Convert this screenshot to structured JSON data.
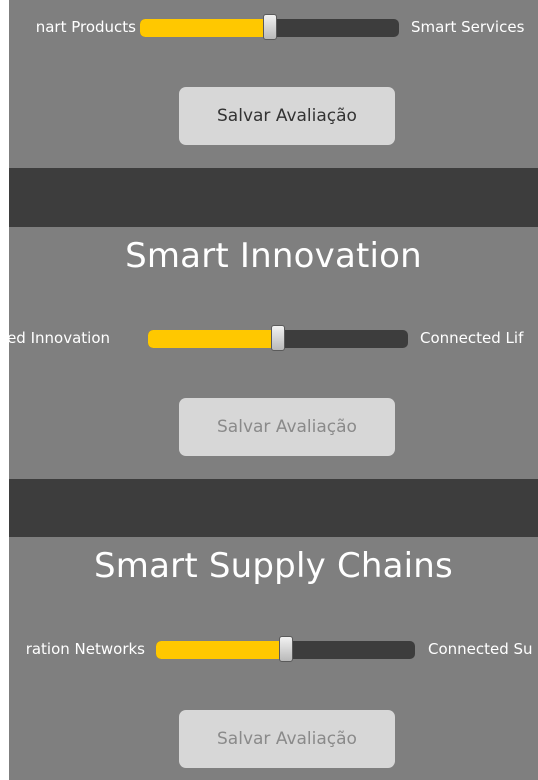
{
  "colors": {
    "panel_background": "#7f7f7f",
    "section_band": "#3d3d3d",
    "slider_fill": "#ffc800",
    "slider_track": "#3d3d3d",
    "button_background": "#d7d7d7"
  },
  "sections": [
    {
      "title": "",
      "left_label": "nart Products",
      "right_label": "Smart Services",
      "slider_value": 0.5,
      "save_label": "Salvar Avaliação",
      "save_enabled": true
    },
    {
      "title": "Smart Innovation",
      "left_label": "ided Innovation",
      "right_label": "Connected Lif",
      "slider_value": 0.5,
      "save_label": "Salvar Avaliação",
      "save_enabled": false
    },
    {
      "title": "Smart Supply Chains",
      "left_label": "ration Networks",
      "right_label": "Connected Su",
      "slider_value": 0.5,
      "save_label": "Salvar Avaliação",
      "save_enabled": false
    }
  ]
}
